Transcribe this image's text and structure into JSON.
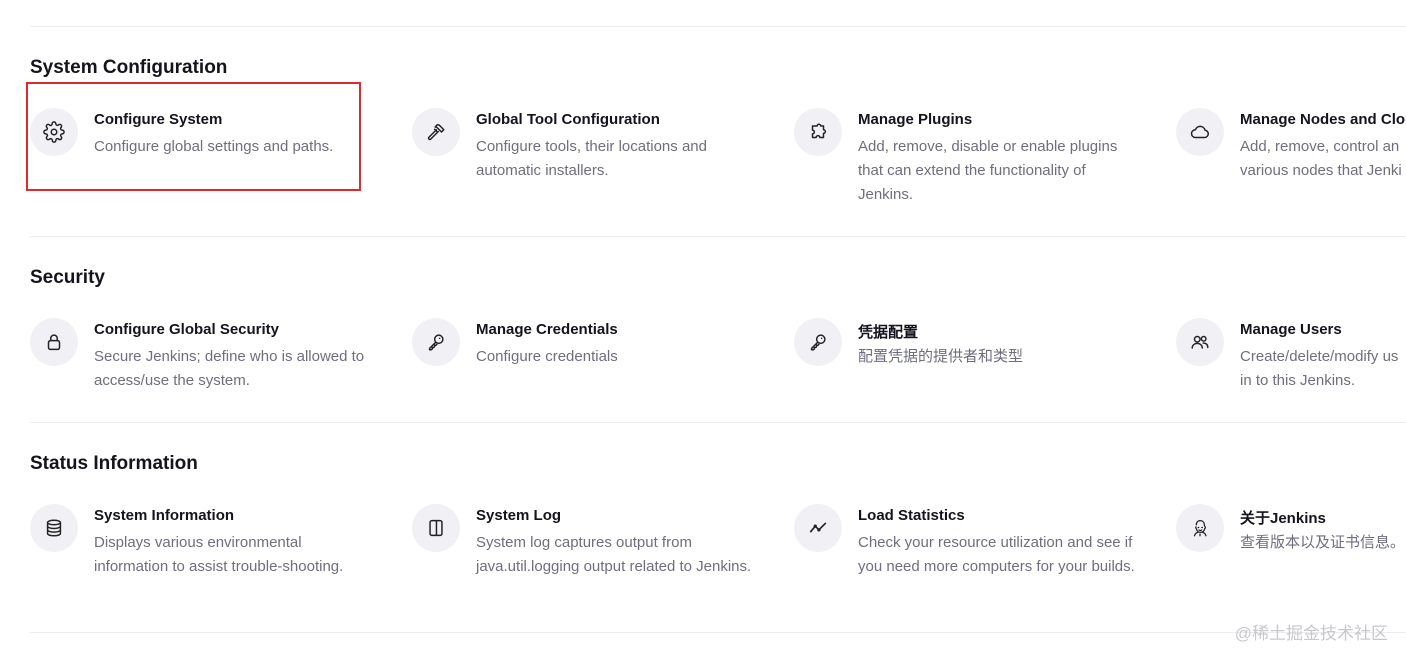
{
  "sections": [
    {
      "title": "System Configuration",
      "items": [
        {
          "icon": "gear-icon",
          "title": "Configure System",
          "description": "Configure global settings and paths."
        },
        {
          "icon": "hammer-icon",
          "title": "Global Tool Configuration",
          "description": "Configure tools, their locations and automatic installers."
        },
        {
          "icon": "puzzle-icon",
          "title": "Manage Plugins",
          "description": "Add, remove, disable or enable plugins that can extend the functionality of Jenkins."
        },
        {
          "icon": "cloud-icon",
          "title": "Manage Nodes and Clo",
          "description": "Add, remove, control an various nodes that Jenki"
        }
      ]
    },
    {
      "title": "Security",
      "items": [
        {
          "icon": "lock-icon",
          "title": "Configure Global Security",
          "description": "Secure Jenkins; define who is allowed to access/use the system."
        },
        {
          "icon": "key-icon",
          "title": "Manage Credentials",
          "description": "Configure credentials"
        },
        {
          "icon": "key-icon",
          "title": "凭据配置",
          "description": "配置凭据的提供者和类型"
        },
        {
          "icon": "users-icon",
          "title": "Manage Users",
          "description": "Create/delete/modify us in to this Jenkins."
        }
      ]
    },
    {
      "title": "Status Information",
      "items": [
        {
          "icon": "database-icon",
          "title": "System Information",
          "description": "Displays various environmental information to assist trouble-shooting."
        },
        {
          "icon": "log-icon",
          "title": "System Log",
          "description": "System log captures output from java.util.logging output related to Jenkins."
        },
        {
          "icon": "line-chart-icon",
          "title": "Load Statistics",
          "description": "Check your resource utilization and see if you need more computers for your builds."
        },
        {
          "icon": "jenkins-logo-icon",
          "title": "关于Jenkins",
          "description": "查看版本以及证书信息。"
        }
      ]
    }
  ],
  "watermark": "@稀土掘金技术社区",
  "colors": {
    "highlight": "#e0292a",
    "icon_bg": "#f1f1f5",
    "text": "#14141f",
    "muted": "#6e6e7e"
  }
}
